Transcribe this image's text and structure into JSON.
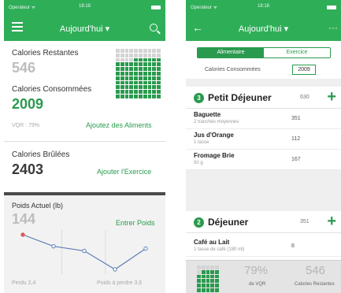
{
  "colors": {
    "primary": "#2fae58",
    "accent": "#2a9a4e"
  },
  "left": {
    "status": {
      "carrier": "Operateur ᯤ",
      "time": "18:18"
    },
    "nav": {
      "title": "Aujourd'hui ▾",
      "menu_icon": "hamburger-icon",
      "search_icon": "search-icon"
    },
    "calories": {
      "remaining_label": "Calories Restantes",
      "remaining_value": "546",
      "consumed_label": "Calories Consommées",
      "consumed_value": "2009",
      "vqr_text": "VQR : 79%",
      "add_food_link": "Ajoutez des Aliments"
    },
    "burned": {
      "label": "Calories Brûlées",
      "value": "2403",
      "add_exercise_link": "Ajouter l'Exercice"
    },
    "weight": {
      "label": "Poids Actuel (lb)",
      "value": "144",
      "enter_link": "Entrer Poids",
      "left_note": "Perdu 2,4",
      "right_note": "Poids à perdre 3,6",
      "trend": [
        3,
        2,
        1.6,
        0,
        1.8
      ]
    }
  },
  "right": {
    "status": {
      "carrier": "Operateur ᯤ",
      "time": "18:18"
    },
    "nav": {
      "title": "Aujourd'hui ▾",
      "back_icon": "back-arrow-icon",
      "more_icon": "more-icon"
    },
    "tabs": [
      "Alimentaire",
      "Exercice"
    ],
    "consumed": {
      "label": "Calories Consommées",
      "value": "2009"
    },
    "sections": [
      {
        "number": "3",
        "title": "Petit Déjeuner",
        "calories": "630",
        "items": [
          {
            "name": "Baguette",
            "serving": "2 tranches moyennes",
            "calories": "351"
          },
          {
            "name": "Jus d'Orange",
            "serving": "1 tasse",
            "calories": "112"
          },
          {
            "name": "Fromage Brie",
            "serving": "50 g",
            "calories": "167"
          }
        ]
      },
      {
        "number": "2",
        "title": "Déjeuner",
        "calories": "351",
        "items": [
          {
            "name": "Café au Lait",
            "serving": "1 tasse de café (180 ml)",
            "calories": "8"
          }
        ]
      }
    ],
    "footer": {
      "pct_value": "79%",
      "pct_label": "de VQR",
      "remaining_value": "546",
      "remaining_label": "Calories Restantes"
    }
  }
}
